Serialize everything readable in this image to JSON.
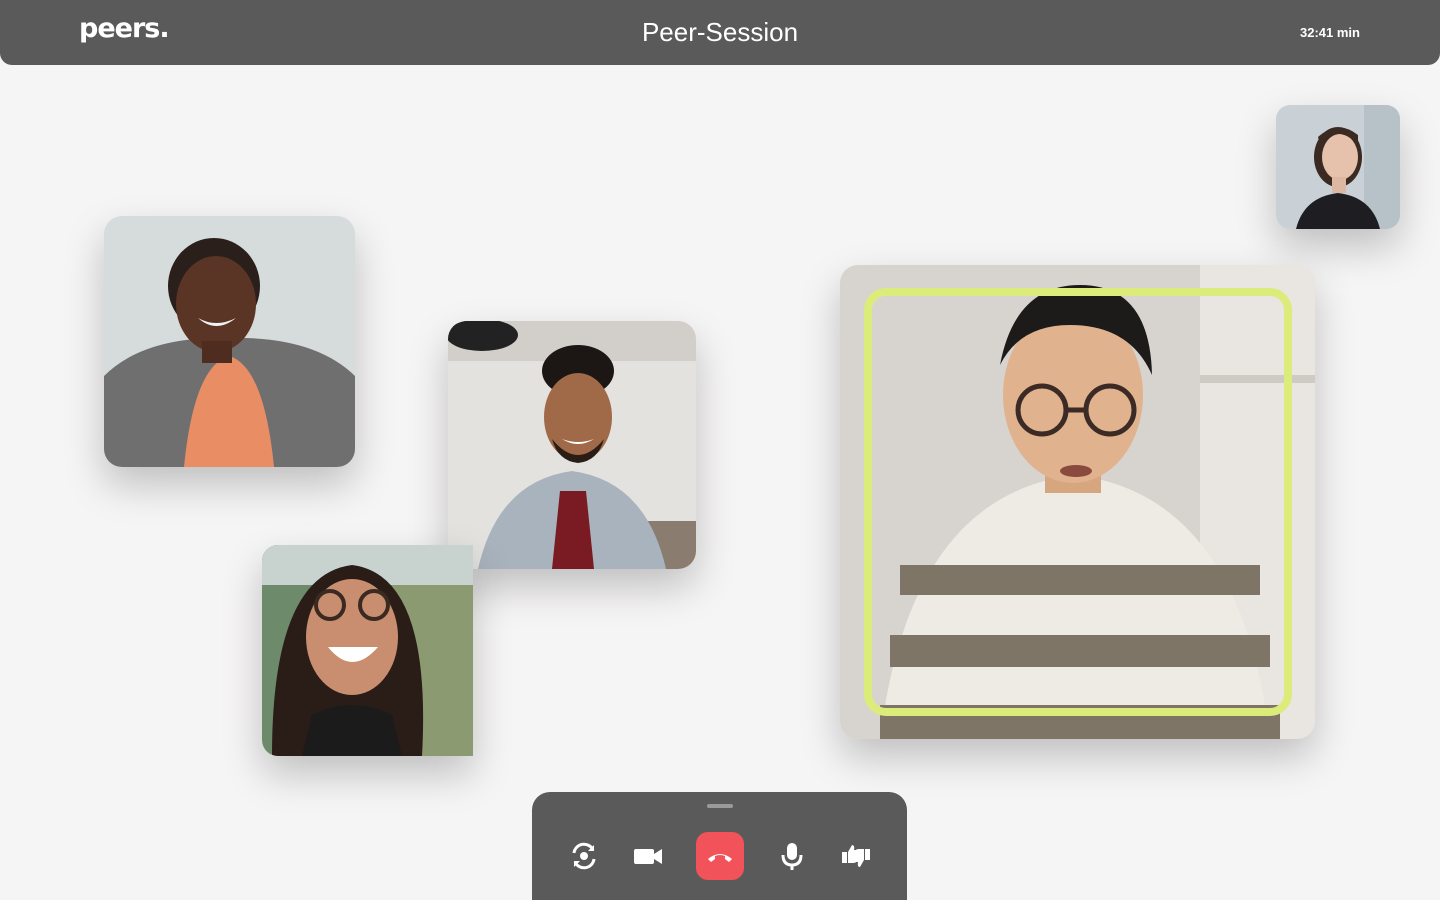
{
  "header": {
    "logo": "peers.",
    "title": "Peer-Session",
    "timer": "32:41 min"
  },
  "participants": [
    {
      "name_tag": "participant-self-preview"
    },
    {
      "name_tag": "participant-woman-blazer"
    },
    {
      "name_tag": "participant-man-denim"
    },
    {
      "name_tag": "participant-woman-glasses"
    },
    {
      "name_tag": "participant-active-speaker"
    }
  ],
  "controls": {
    "items": [
      {
        "icon": "switch-camera-icon"
      },
      {
        "icon": "video-camera-icon"
      },
      {
        "icon": "end-call-icon"
      },
      {
        "icon": "microphone-icon"
      },
      {
        "icon": "feedback-thumbs-icon"
      }
    ]
  },
  "colors": {
    "topbar": "#5a5a5a",
    "speaking_highlight": "#dbec7a",
    "end_call": "#f2525a"
  }
}
